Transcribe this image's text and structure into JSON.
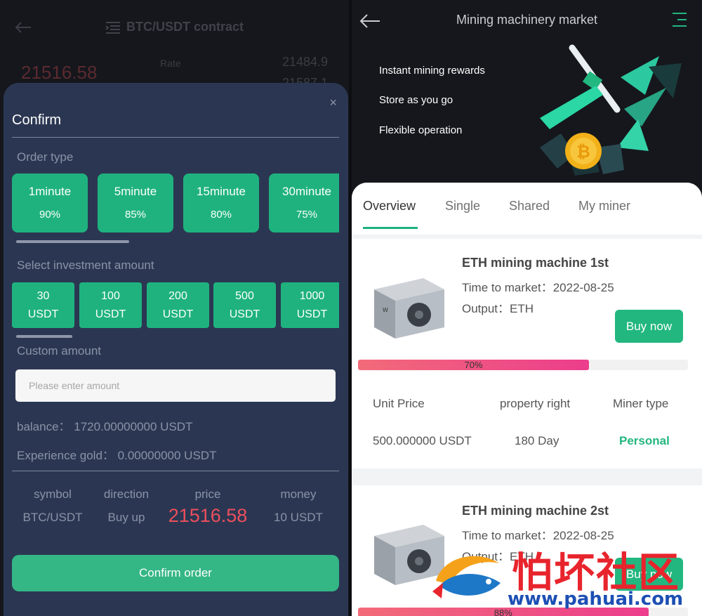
{
  "left": {
    "header_title": "BTC/USDT contract",
    "bg_price": "21516.58",
    "bg_label": "Rate",
    "bg_num1": "21484.9",
    "bg_num2": "21587.1"
  },
  "confirm": {
    "title": "Confirm",
    "close_glyph": "×",
    "order_type_label": "Order type",
    "order_types": [
      {
        "time": "1minute",
        "pct": "90%"
      },
      {
        "time": "5minute",
        "pct": "85%"
      },
      {
        "time": "15minute",
        "pct": "80%"
      },
      {
        "time": "30minute",
        "pct": "75%"
      }
    ],
    "investment_label": "Select investment amount",
    "amounts": [
      {
        "value": "30",
        "unit": "USDT"
      },
      {
        "value": "100",
        "unit": "USDT"
      },
      {
        "value": "200",
        "unit": "USDT"
      },
      {
        "value": "500",
        "unit": "USDT"
      },
      {
        "value": "1000",
        "unit": "USDT"
      }
    ],
    "custom_label": "Custom amount",
    "custom_placeholder": "Please enter amount",
    "balance": "balance：  1720.00000000 USDT",
    "experience": "Experience gold：  0.00000000 USDT",
    "summary": {
      "headers": [
        "symbol",
        "direction",
        "price",
        "money"
      ],
      "values": [
        "BTC/USDT",
        "Buy up",
        "21516.58",
        "10 USDT"
      ]
    },
    "confirm_button": "Confirm order"
  },
  "market": {
    "title": "Mining machinery market",
    "features": [
      "Instant mining rewards",
      "Store as you go",
      "Flexible operation"
    ],
    "tabs": [
      "Overview",
      "Single",
      "Shared",
      "My miner"
    ],
    "active_tab": "Overview",
    "accent_color": "#22b77f",
    "machines": [
      {
        "name": "ETH mining machine 1st",
        "time_to_market": "Time to market：2022-08-25",
        "output": "Output：ETH",
        "buy": "Buy now",
        "progress": 70,
        "progress_label": "70%",
        "table_headers": [
          "Unit Price",
          "property right",
          "Miner type"
        ],
        "table_values": [
          "500.000000 USDT",
          "180 Day",
          "Personal"
        ]
      },
      {
        "name": "ETH mining machine 2st",
        "time_to_market": "Time to market：2022-08-25",
        "output": "Output：ETH",
        "buy": "Buy now",
        "progress": 88,
        "progress_label": "88%"
      }
    ]
  },
  "watermark": {
    "cn_text": "怕坏社区",
    "url": "www.pahuai.com"
  }
}
